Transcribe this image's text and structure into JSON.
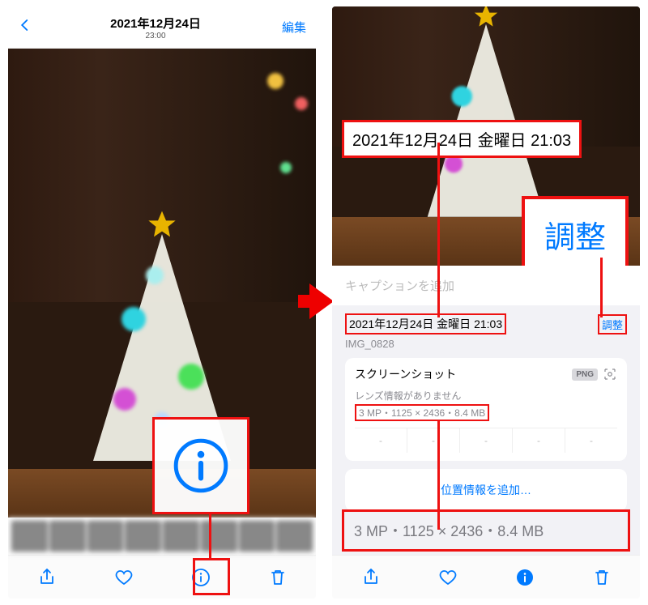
{
  "left": {
    "date": "2021年12月24日",
    "time": "23:00",
    "edit": "編集"
  },
  "right": {
    "caption_placeholder": "キャプションを追加",
    "datetime": "2021年12月24日 金曜日 21:03",
    "adjust": "調整",
    "filename": "IMG_0828",
    "media_type": "スクリーンショット",
    "format_badge": "PNG",
    "lens_info": "レンズ情報がありません",
    "dimensions": "3 MP・1125 × 2436・8.4 MB",
    "exif": [
      "-",
      "-",
      "-",
      "-",
      "-"
    ],
    "add_location": "位置情報を追加…"
  },
  "callouts": {
    "date_large": "2021年12月24日 金曜日 21:03",
    "adjust_large": "調整",
    "dims_large": "3 MP・1125 × 2436・8.4 MB"
  }
}
